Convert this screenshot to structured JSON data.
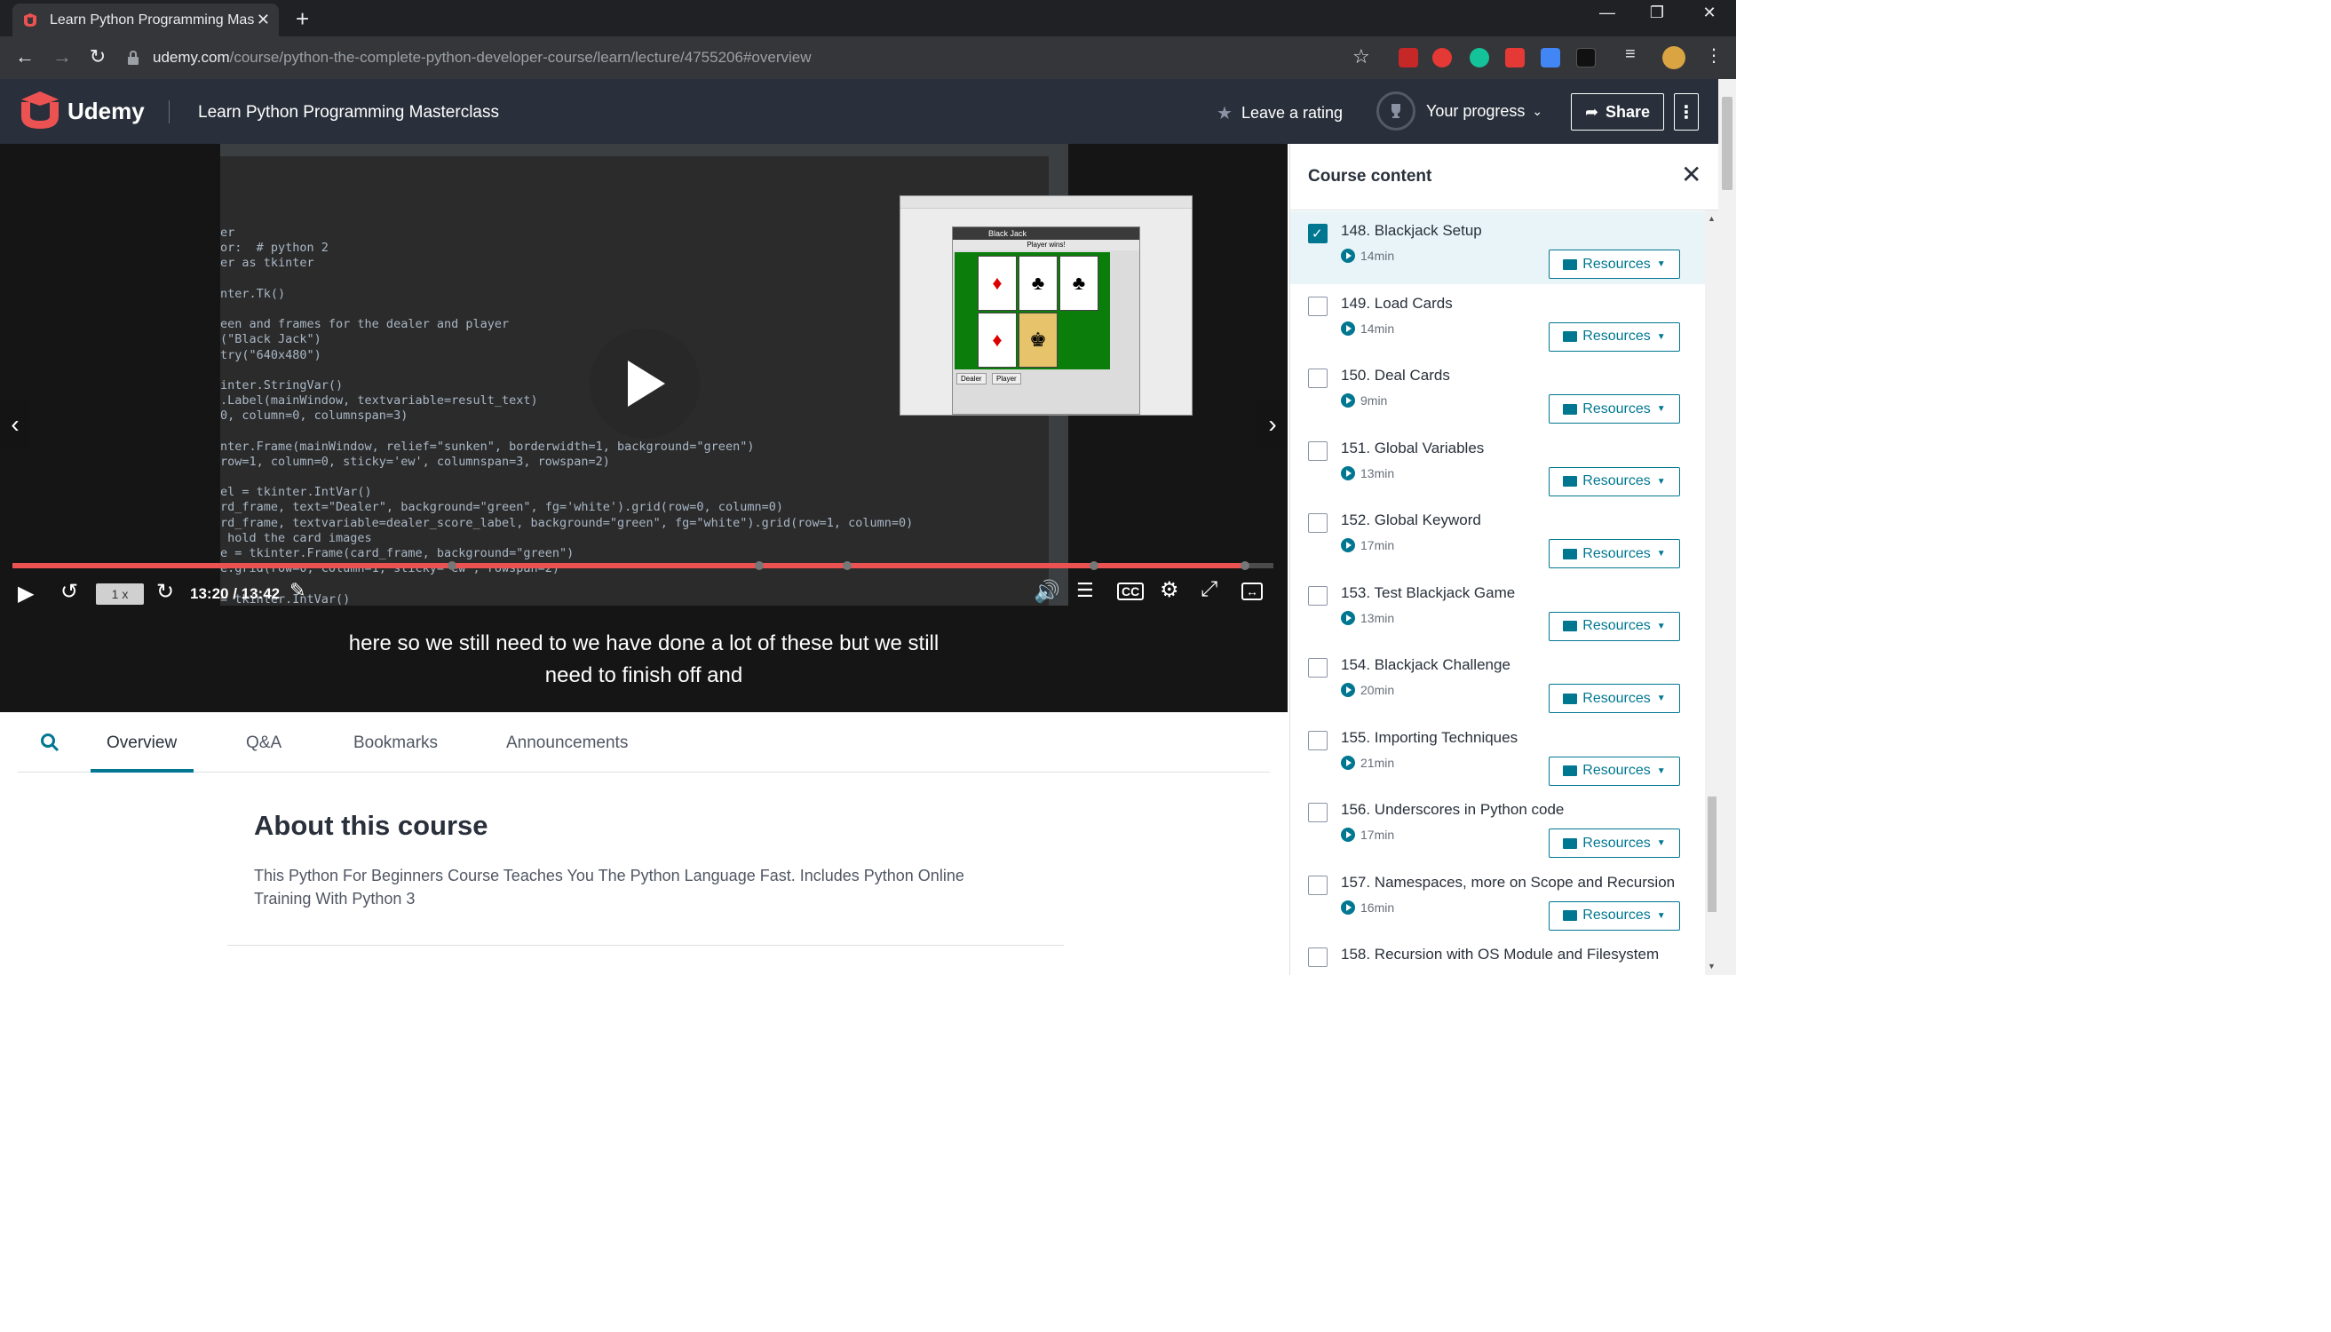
{
  "browser": {
    "tab_title": "Learn Python Programming Mast",
    "url_host": "udemy.com",
    "url_path": "/course/python-the-complete-python-developer-course/learn/lecture/4755206#overview"
  },
  "header": {
    "brand": "Udemy",
    "course_title": "Learn Python Programming Masterclass",
    "rating_label": "Leave a rating",
    "progress_label": "Your progress",
    "share_label": "Share"
  },
  "player": {
    "speed": "1 x",
    "time": "13:20 / 13:42",
    "caption_line1": "here so we still need to we have done a lot of these but we still",
    "caption_line2": "need to finish off and",
    "progress_fraction": 0.976
  },
  "tabs": [
    {
      "label": "Overview",
      "active": true
    },
    {
      "label": "Q&A",
      "active": false
    },
    {
      "label": "Bookmarks",
      "active": false
    },
    {
      "label": "Announcements",
      "active": false
    }
  ],
  "about": {
    "heading": "About this course",
    "description": "This Python For Beginners Course Teaches You The Python Language Fast. Includes Python Online Training With Python 3"
  },
  "sidebar": {
    "title": "Course content",
    "resources_label": "Resources",
    "lectures": [
      {
        "title": "148. Blackjack Setup",
        "duration": "14min",
        "checked": true
      },
      {
        "title": "149. Load Cards",
        "duration": "14min",
        "checked": false
      },
      {
        "title": "150. Deal Cards",
        "duration": "9min",
        "checked": false
      },
      {
        "title": "151. Global Variables",
        "duration": "13min",
        "checked": false
      },
      {
        "title": "152. Global Keyword",
        "duration": "17min",
        "checked": false
      },
      {
        "title": "153. Test Blackjack Game",
        "duration": "13min",
        "checked": false
      },
      {
        "title": "154. Blackjack Challenge",
        "duration": "20min",
        "checked": false
      },
      {
        "title": "155. Importing Techniques",
        "duration": "21min",
        "checked": false
      },
      {
        "title": "156. Underscores in Python code",
        "duration": "17min",
        "checked": false
      },
      {
        "title": "157. Namespaces, more on Scope and Recursion",
        "duration": "16min",
        "checked": false
      },
      {
        "title": "158. Recursion with OS Module and Filesystem",
        "duration": "",
        "checked": false
      }
    ]
  },
  "video_code": {
    "lines": [
      "er",
      "or:  # python 2",
      "er as tkinter",
      "",
      "nter.Tk()",
      "",
      "een and frames for the dealer and player",
      "(\"Black Jack\")",
      "try(\"640x480\")",
      "",
      "inter.StringVar()",
      ".Label(mainWindow, textvariable=result_text)",
      "0, column=0, columnspan=3)",
      "",
      "nter.Frame(mainWindow, relief=\"sunken\", borderwidth=1, background=\"green\")",
      "row=1, column=0, sticky='ew', columnspan=3, rowspan=2)",
      "",
      "el = tkinter.IntVar()",
      "rd_frame, text=\"Dealer\", background=\"green\", fg='white').grid(row=0, column=0)",
      "rd_frame, textvariable=dealer_score_label, background=\"green\", fg=\"white\").grid(row=1, column=0)",
      " hold the card images",
      "e = tkinter.Frame(card_frame, background=\"green\")",
      "e.grid(row=0, column=1, sticky=\"ew\", rowspan=2)",
      "",
      "= tkinter.IntVar()"
    ],
    "window_title": "Black Jack",
    "window_result": "Player wins!",
    "dealer_button": "Dealer",
    "player_button": "Player"
  },
  "colors": {
    "udemy_red": "#ec5252",
    "accent": "#007791",
    "header_bg": "#29303b"
  }
}
